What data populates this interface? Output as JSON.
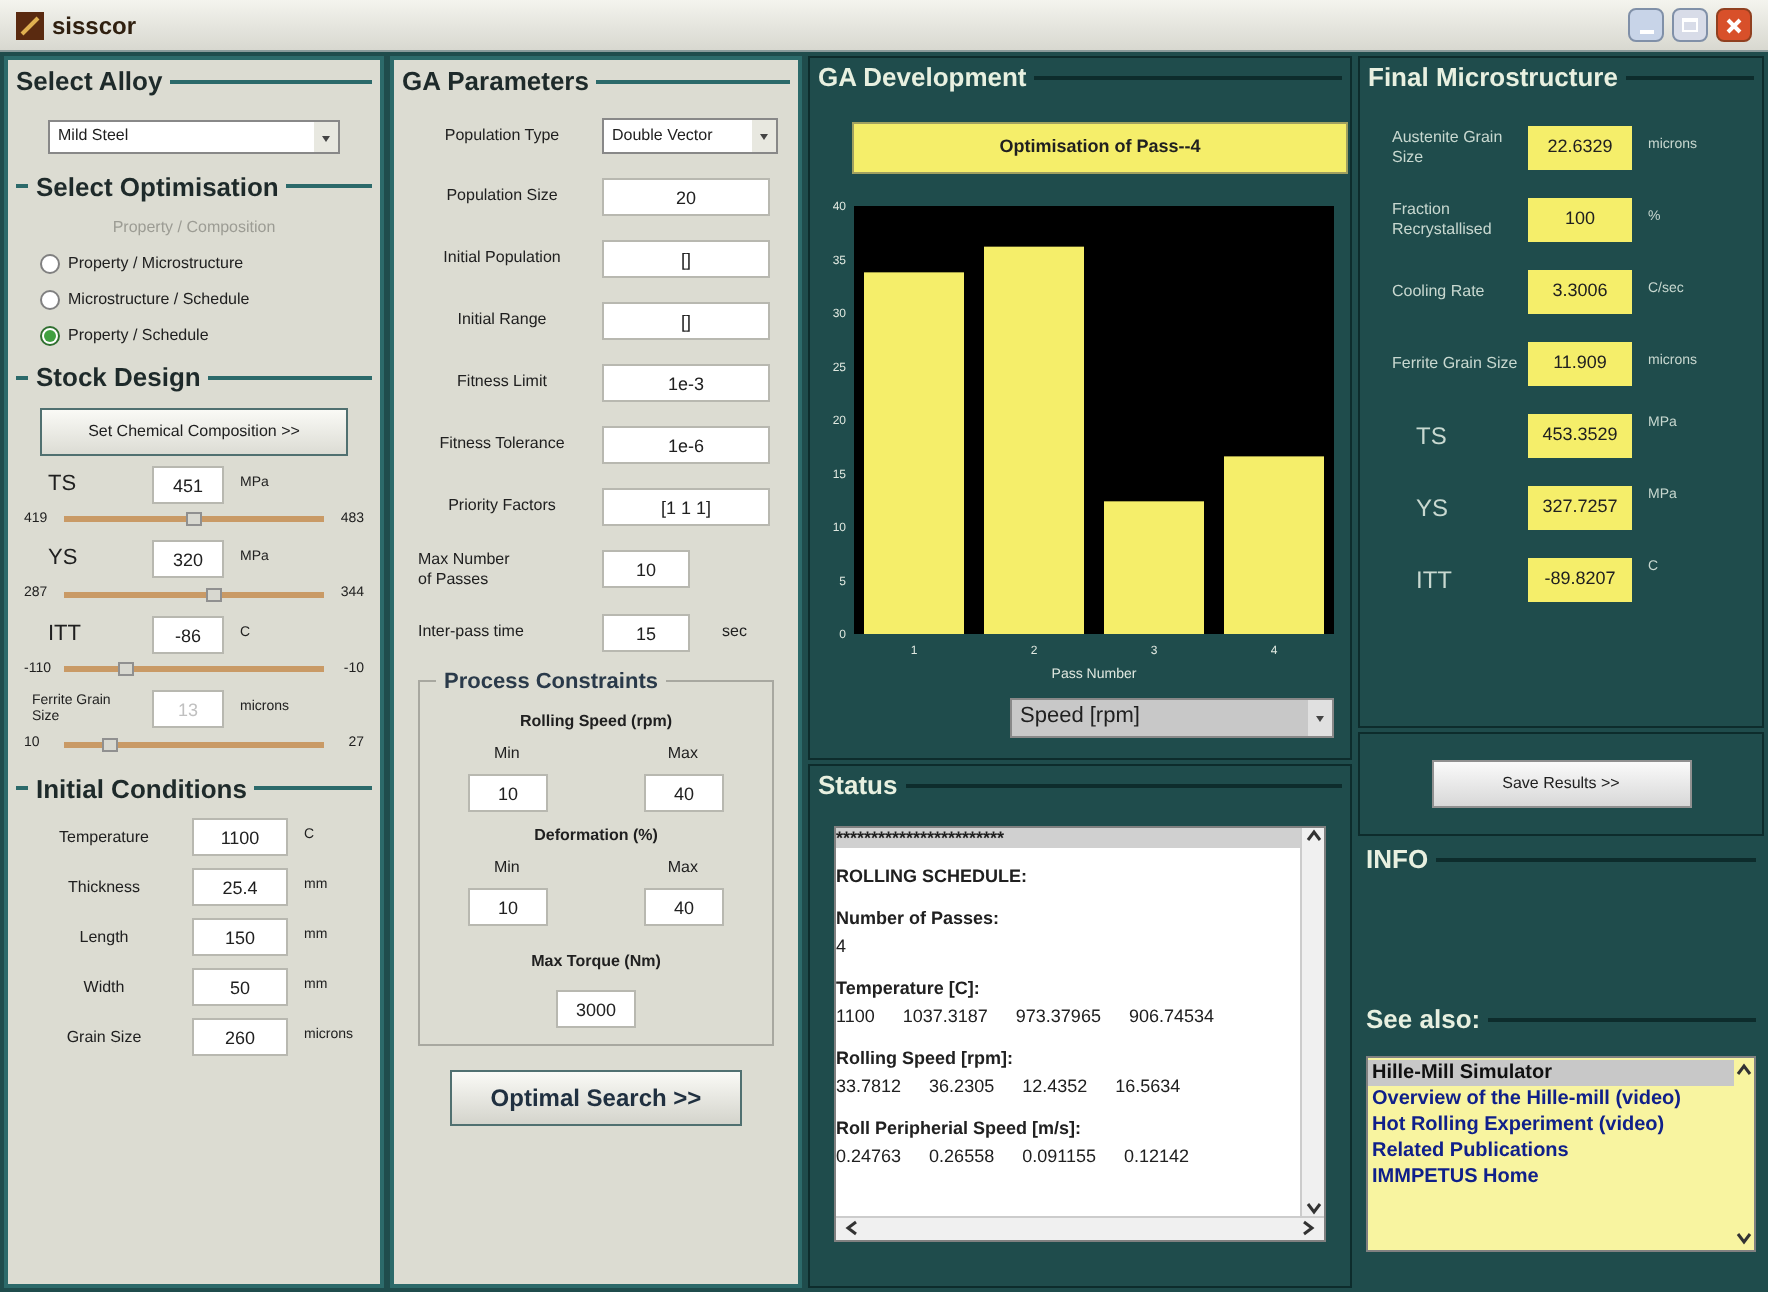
{
  "window": {
    "title": "sisscor"
  },
  "select_alloy": {
    "title": "Select Alloy",
    "value": "Mild Steel"
  },
  "select_optimisation": {
    "title": "Select Optimisation",
    "options": [
      {
        "label": "Property / Composition",
        "disabled": true,
        "selected": false
      },
      {
        "label": "Property / Microstructure",
        "disabled": false,
        "selected": false
      },
      {
        "label": "Microstructure / Schedule",
        "disabled": false,
        "selected": false
      },
      {
        "label": "Property / Schedule",
        "disabled": false,
        "selected": true
      }
    ]
  },
  "stock_design": {
    "title": "Stock Design",
    "button": "Set Chemical Composition >>",
    "properties": [
      {
        "label": "TS",
        "value": "451",
        "unit": "MPa",
        "min": "419",
        "max": "483",
        "level": 0.5,
        "disabled": false
      },
      {
        "label": "YS",
        "value": "320",
        "unit": "MPa",
        "min": "287",
        "max": "344",
        "level": 0.58,
        "disabled": false
      },
      {
        "label": "ITT",
        "value": "-86",
        "unit": "C",
        "min": "-110",
        "max": "-10",
        "level": 0.24,
        "disabled": false
      },
      {
        "label": "Ferrite Grain Size",
        "value": "13",
        "unit": "microns",
        "min": "10",
        "max": "27",
        "level": 0.18,
        "disabled": true
      }
    ]
  },
  "initial_conditions": {
    "title": "Initial Conditions",
    "fields": [
      {
        "label": "Temperature",
        "value": "1100",
        "unit": "C"
      },
      {
        "label": "Thickness",
        "value": "25.4",
        "unit": "mm"
      },
      {
        "label": "Length",
        "value": "150",
        "unit": "mm"
      },
      {
        "label": "Width",
        "value": "50",
        "unit": "mm"
      },
      {
        "label": "Grain Size",
        "value": "260",
        "unit": "microns"
      }
    ]
  },
  "ga_parameters": {
    "title": "GA Parameters",
    "population_type": {
      "label": "Population Type",
      "value": "Double Vector"
    },
    "fields": [
      {
        "label": "Population Size",
        "value": "20",
        "kind": "wide"
      },
      {
        "label": "Initial Population",
        "value": "[]",
        "kind": "wide"
      },
      {
        "label": "Initial Range",
        "value": "[]",
        "kind": "wide"
      },
      {
        "label": "Fitness Limit",
        "value": "1e-3",
        "kind": "wide"
      },
      {
        "label": "Fitness Tolerance",
        "value": "1e-6",
        "kind": "wide"
      },
      {
        "label": "Priority Factors",
        "value": "[1 1 1]",
        "kind": "wide"
      },
      {
        "label": "Max Number of Passes",
        "value": "10",
        "kind": "narrow"
      },
      {
        "label": "Inter-pass time",
        "value": "15",
        "unit": "sec",
        "kind": "narrow"
      }
    ],
    "process_constraints": {
      "title": "Process Constraints",
      "groups": [
        {
          "title": "Rolling Speed (rpm)",
          "min_label": "Min",
          "max_label": "Max",
          "min": "10",
          "max": "40"
        },
        {
          "title": "Deformation (%)",
          "min_label": "Min",
          "max_label": "Max",
          "min": "10",
          "max": "40"
        }
      ],
      "max_torque": {
        "label": "Max Torque (Nm)",
        "value": "3000"
      }
    },
    "button": "Optimal Search >>"
  },
  "ga_development": {
    "title": "GA Development",
    "chart_data": {
      "type": "bar",
      "title": "Optimisation of Pass--4",
      "xlabel": "Pass Number",
      "categories": [
        "1",
        "2",
        "3",
        "4"
      ],
      "series": [
        {
          "name": "Speed [rpm]",
          "color": "#f5ee6a",
          "values": [
            33.8,
            36.2,
            12.4,
            16.6
          ]
        }
      ],
      "ylim": [
        0,
        40
      ],
      "yticks": [
        0,
        5,
        10,
        15,
        20,
        25,
        30,
        35,
        40
      ]
    }
  },
  "status": {
    "title": "Status",
    "separator": "************************",
    "entries": [
      {
        "heading": "ROLLING SCHEDULE:"
      },
      {
        "heading": "Number of Passes:",
        "values": [
          "4"
        ]
      },
      {
        "heading": "Temperature [C]:",
        "values": [
          "1100",
          "1037.3187",
          "973.37965",
          "906.74534"
        ]
      },
      {
        "heading": "Rolling Speed [rpm]:",
        "values": [
          "33.7812",
          "36.2305",
          "12.4352",
          "16.5634"
        ]
      },
      {
        "heading": "Roll Peripherial Speed [m/s]:",
        "values": [
          "0.24763",
          "0.26558",
          "0.091155",
          "0.12142"
        ]
      }
    ]
  },
  "final_microstructure": {
    "title": "Final Microstructure",
    "fields": [
      {
        "label": "Austenite Grain Size",
        "value": "22.6329",
        "unit": "microns"
      },
      {
        "label": "Fraction Recrystallised",
        "value": "100",
        "unit": "%"
      },
      {
        "label": "Cooling Rate",
        "value": "3.3006",
        "unit": "C/sec"
      },
      {
        "label": "Ferrite Grain Size",
        "value": "11.909",
        "unit": "microns"
      },
      {
        "label": "TS",
        "value": "453.3529",
        "unit": "MPa",
        "kind": "big"
      },
      {
        "label": "YS",
        "value": "327.7257",
        "unit": "MPa",
        "kind": "big"
      },
      {
        "label": "ITT",
        "value": "-89.8207",
        "unit": "C",
        "kind": "big"
      }
    ]
  },
  "save_button": "Save Results >>",
  "info": {
    "title": "INFO"
  },
  "see_also": {
    "title": "See also:",
    "items": [
      {
        "label": "Hille-Mill Simulator",
        "selected": true
      },
      {
        "label": "Overview of the Hille-mill (video)",
        "selected": false
      },
      {
        "label": "Hot Rolling Experiment (video)",
        "selected": false
      },
      {
        "label": "Related Publications",
        "selected": false
      },
      {
        "label": "IMMPETUS Home",
        "selected": false
      }
    ]
  }
}
